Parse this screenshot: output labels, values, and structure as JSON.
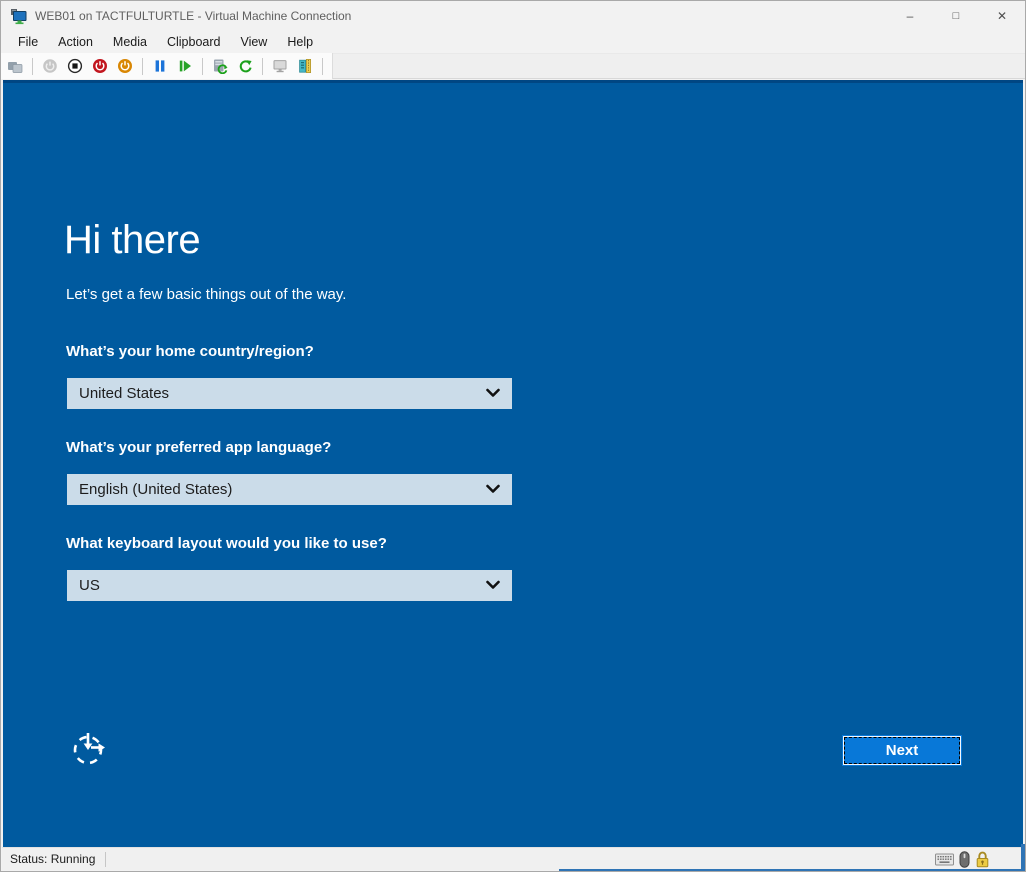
{
  "window": {
    "title": "WEB01 on TACTFULTURTLE - Virtual Machine Connection",
    "controls": {
      "minimize": "–",
      "maximize": "□",
      "close": "✕"
    }
  },
  "menu": {
    "items": [
      "File",
      "Action",
      "Media",
      "Clipboard",
      "View",
      "Help"
    ]
  },
  "toolbar": {
    "buttons": [
      "ctrl-alt-delete",
      "start",
      "turn-off",
      "shut-down",
      "save",
      "pause",
      "reset",
      "checkpoint",
      "revert",
      "basic-session",
      "share"
    ]
  },
  "vm_screen": {
    "title": "Hi there",
    "subtitle": "Let’s get a few basic things out of the way.",
    "fields": [
      {
        "label": "What’s your home country/region?",
        "value": "United States"
      },
      {
        "label": "What’s your preferred app language?",
        "value": "English (United States)"
      },
      {
        "label": "What keyboard layout would you like to use?",
        "value": "US"
      }
    ],
    "next_label": "Next"
  },
  "statusbar": {
    "status_label": "Status: Running"
  },
  "colors": {
    "oobe_background": "#005A9F",
    "dropdown_background": "#CBDCE9",
    "next_button": "#0878D8",
    "titlebar_background": "#F2F2F2"
  }
}
